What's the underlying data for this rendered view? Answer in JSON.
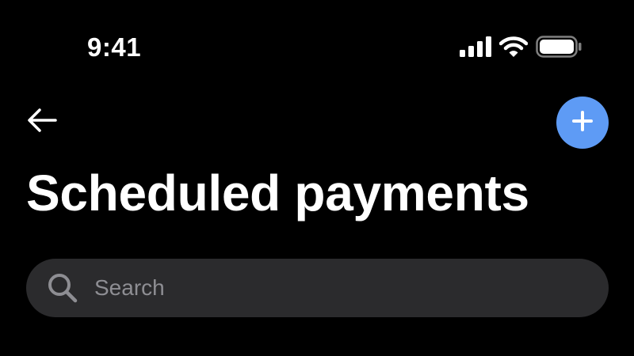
{
  "status_bar": {
    "time": "9:41",
    "icons": [
      "cellular-signal-icon",
      "wifi-icon",
      "battery-icon"
    ]
  },
  "header": {
    "back_icon": "back-arrow-icon",
    "add_icon": "plus-icon",
    "title": "Scheduled payments"
  },
  "search": {
    "icon": "search-icon",
    "placeholder": "Search",
    "value": ""
  },
  "colors": {
    "background": "#000000",
    "text": "#ffffff",
    "accent": "#5e9bf5",
    "search_background": "#2b2b2d",
    "placeholder": "#8e8e93"
  }
}
